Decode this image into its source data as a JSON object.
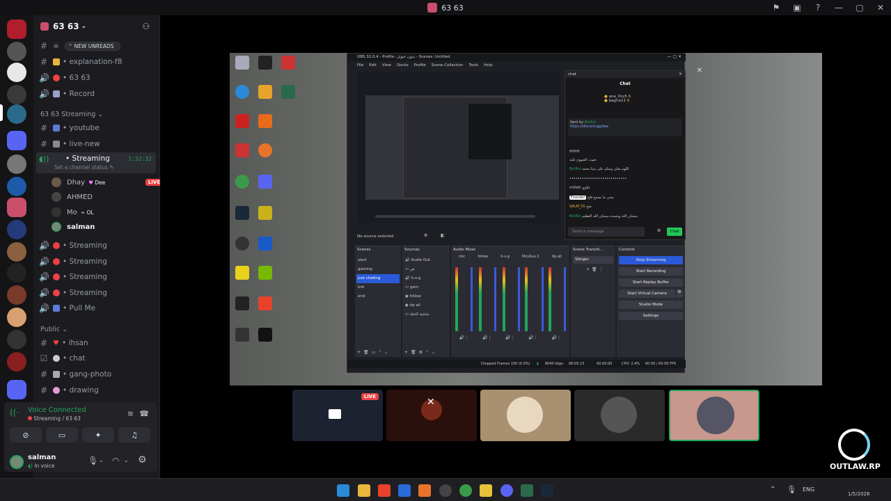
{
  "titlebar": {
    "title": "63 63"
  },
  "server": {
    "name": "63 63",
    "new_unreads": "NEW UNREADS",
    "channels_top": [
      {
        "name": "",
        "type": "text",
        "emoji_color": "#cccccc"
      },
      {
        "name": "• explanation-f8",
        "type": "text",
        "emoji_color": "#e8b63a"
      },
      {
        "name": "• 63 63",
        "type": "voice",
        "emoji_color": "#ed4245"
      },
      {
        "name": "• Record",
        "type": "voice",
        "emoji_color": "#9aa0c8"
      }
    ],
    "category_streaming": "63 63 Streaming",
    "channels_streaming": [
      {
        "name": "• youtube",
        "type": "text",
        "emoji_color": "#5b7bd6"
      },
      {
        "name": "• live-new",
        "type": "text",
        "emoji_color": "#8a8a8a"
      }
    ],
    "active_voice": {
      "name": "• Streaming",
      "timer": "1:32:32",
      "status_placeholder": "Set a channel status",
      "users": [
        {
          "name": "Dhay",
          "tag": "Dee",
          "live": "LIVE",
          "avatar_color": "#6a5a4a"
        },
        {
          "name": "AHMED",
          "avatar_color": "#444"
        },
        {
          "name": "Mo",
          "tag": "OL",
          "avatar_color": "#333"
        },
        {
          "name": "salman",
          "avatar_color": "#778877"
        }
      ]
    },
    "voice_more": [
      {
        "name": "• Streaming"
      },
      {
        "name": "• Streaming"
      },
      {
        "name": "• Streaming"
      },
      {
        "name": "• Streaming"
      },
      {
        "name": "• Pull Me"
      }
    ],
    "category_public": "Public",
    "channels_public": [
      {
        "name": "• ihsan",
        "emoji_color": "#ed4245"
      },
      {
        "name": "• chat",
        "emoji_color": "#cccccc"
      },
      {
        "name": "• gang-photo",
        "emoji_color": "#aaaaaa"
      },
      {
        "name": "• drawing",
        "emoji_color": "#e79ad6"
      }
    ]
  },
  "voice_panel": {
    "status": "Voice Connected",
    "location": "Streaming / 63 63",
    "user": "salman",
    "user_status": "In voice"
  },
  "obs": {
    "title": "OBS 32.0.4 - Profile: بدون عنوان - Scenes: Untitled",
    "menu": [
      "File",
      "Edit",
      "View",
      "Docks",
      "Profile",
      "Scene Collection",
      "Tools",
      "Help"
    ],
    "no_source": "No source selected",
    "scenes_title": "Scenes",
    "scenes": [
      "start",
      "gaming",
      "just chating",
      "brb",
      "end"
    ],
    "sources_title": "Sources",
    "sources": [
      "Audio Out",
      "ص",
      "h-s-g",
      "gem",
      "follow",
      "tip all",
      "شاشة كاملة"
    ],
    "mixer_title": "Audio Mixer",
    "mixer_channels": [
      "mic",
      "follow",
      "h-s-g",
      "Mic/Aux 2",
      "tip all"
    ],
    "transitions_title": "Scene Transiti...",
    "transition": "Stinger",
    "controls_title": "Controls",
    "controls": [
      "Stop Streaming",
      "Start Recording",
      "Start Replay Buffer",
      "Start Virtual Camera",
      "Studio Mode",
      "Settings"
    ],
    "status": {
      "dropped": "Dropped Frames 150 (0.0%)",
      "bitrate": "8040 kbps",
      "time": "06:05:13",
      "rec_time": "00:00:00",
      "cpu": "CPU: 2.4%",
      "fps": "60.00 / 60.00 FPS"
    },
    "chat": {
      "dock_title": "chat",
      "title": "Chat",
      "leaders": [
        {
          "name": "ana_0nz5",
          "score": "6"
        },
        {
          "name": "bagira11",
          "score": "6"
        }
      ],
      "pinned_by": "BotRix",
      "pinned_link": "https://discord.gg/dee",
      "messages": [
        {
          "user": "",
          "text": "وووووو"
        },
        {
          "user": "",
          "text": "صوت القيووم عليه"
        },
        {
          "user": "BotRix",
          "text": "اللهم صلي وسلم على نبينا محمد"
        },
        {
          "user": "",
          "text": "••••••••••••••••••••••••••••"
        },
        {
          "user": "m5felt",
          "text": "علاوي"
        },
        {
          "user": "Founder",
          "text": "بيحي ما يسمع فلج"
        },
        {
          "user": "SALM_55",
          "text": "صح"
        },
        {
          "user": "BotRix",
          "text": "سبحان الله وبحمده سبحان الله العظيم"
        }
      ],
      "input_placeholder": "Send a message",
      "send": "Chat"
    }
  },
  "tiles": [
    {
      "live": "LIVE",
      "bg": "#1c2230"
    },
    {
      "bg": "#2a0f0c"
    },
    {
      "bg": "#a89070"
    },
    {
      "bg": "#2a2a2a"
    },
    {
      "bg": "#c8988c"
    }
  ],
  "watermark": "OUTLAW.RP",
  "taskbar": {
    "lang": "ENG",
    "date": "1/5/2026"
  }
}
